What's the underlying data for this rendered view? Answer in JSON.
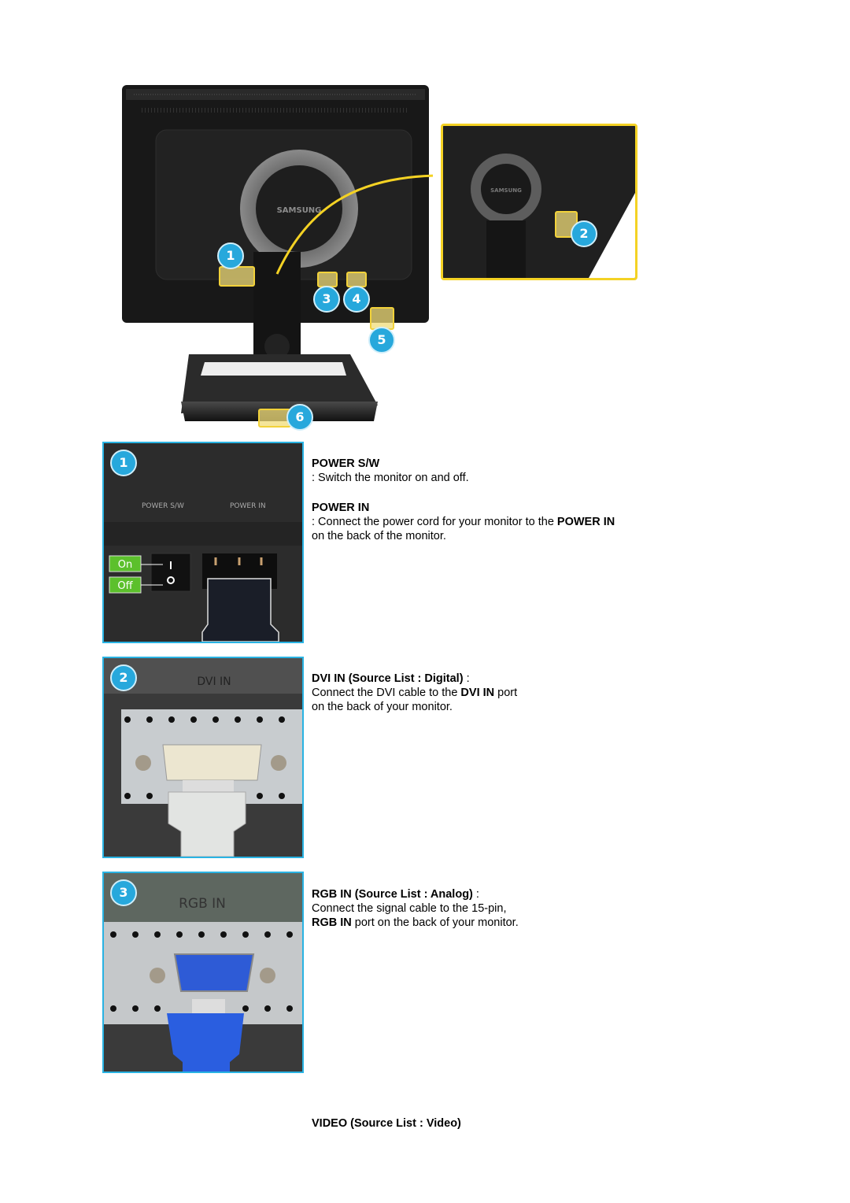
{
  "figure": {
    "monitor_brand": "SAMSUNG",
    "callouts": [
      "1",
      "2",
      "3",
      "4",
      "5",
      "6"
    ],
    "highlight_color": "#f4d224",
    "badge_color": "#27a8dc"
  },
  "sections": [
    {
      "badge": "1",
      "photo_labels": {
        "left": "POWER S/W",
        "right": "POWER IN",
        "on": "On",
        "off": "Off"
      },
      "items": [
        {
          "title": "POWER S/W",
          "desc": ": Switch the monitor on and off."
        },
        {
          "title": "POWER IN",
          "desc_prefix": ": Connect the power cord for your monitor to the ",
          "desc_bold": "POWER IN",
          "desc_suffix": "on the back of the monitor."
        }
      ]
    },
    {
      "badge": "2",
      "photo_label": "DVI IN",
      "title": "DVI IN (Source List : Digital)",
      "title_suffix": " :",
      "desc_prefix": "Connect the DVI cable to the ",
      "desc_bold": "DVI IN",
      "desc_suffix": " port",
      "desc_line2": "on the back of your monitor."
    },
    {
      "badge": "3",
      "photo_label": "RGB IN",
      "title": "RGB IN (Source List : Analog)",
      "title_suffix": " :",
      "desc_line1": "Connect the signal cable to the 15-pin,",
      "desc_bold": "RGB IN",
      "desc_suffix": " port on the back of your monitor."
    },
    {
      "title": "VIDEO (Source List : Video)"
    }
  ]
}
